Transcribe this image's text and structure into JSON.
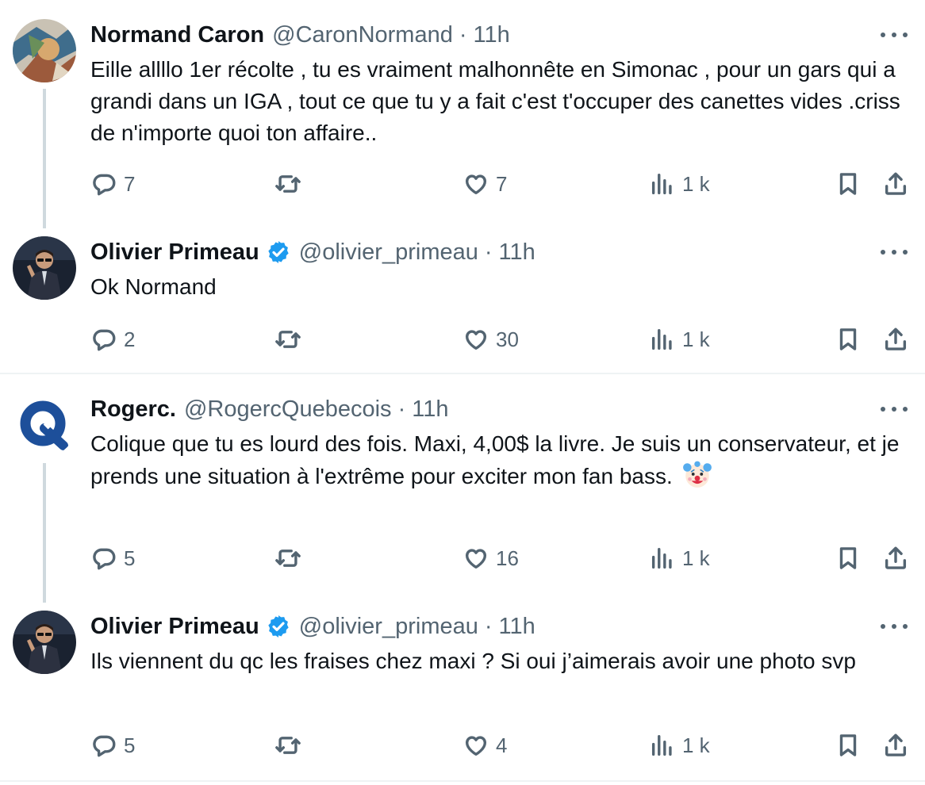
{
  "tweets": [
    {
      "name": "Normand Caron",
      "verified": false,
      "handle": "@CaronNormand",
      "separator": "·",
      "time": "11h",
      "text": "Eille allllo 1er récolte , tu es vraiment malhonnête en Simonac , pour un gars qui a grandi dans un IGA , tout ce que tu y a fait c'est t'occuper des canettes vides .criss de n'importe quoi ton affaire..",
      "replies": "7",
      "retweets": "",
      "likes": "7",
      "views": "1 k"
    },
    {
      "name": "Olivier Primeau",
      "verified": true,
      "handle": "@olivier_primeau",
      "separator": "·",
      "time": "11h",
      "text": "Ok Normand",
      "replies": "2",
      "retweets": "",
      "likes": "30",
      "views": "1 k"
    },
    {
      "name": "Rogerc.",
      "verified": false,
      "handle": "@RogercQuebecois",
      "separator": "·",
      "time": "11h",
      "text": "Colique que tu es lourd des fois. Maxi, 4,00$ la livre. Je suis un conservateur, et je prends une situation à l'extrême pour exciter mon fan bass.",
      "emoji": "clown-face",
      "replies": "5",
      "retweets": "",
      "likes": "16",
      "views": "1 k"
    },
    {
      "name": "Olivier Primeau",
      "verified": true,
      "handle": "@olivier_primeau",
      "separator": "·",
      "time": "11h",
      "text": "Ils viennent du qc les fraises chez maxi ? Si oui j’aimerais avoir une photo svp",
      "replies": "5",
      "retweets": "",
      "likes": "4",
      "views": "1 k"
    }
  ],
  "colors": {
    "text": "#0f1419",
    "secondary": "#536471",
    "verified_blue": "#1d9bf0",
    "thread_line": "#cfd9de",
    "divider": "#eff3f4",
    "rogerc_logo": "#1d4f9a"
  },
  "icons": [
    "reply-icon",
    "retweet-icon",
    "like-icon",
    "views-icon",
    "bookmark-icon",
    "share-icon",
    "more-icon",
    "verified-badge-icon"
  ]
}
